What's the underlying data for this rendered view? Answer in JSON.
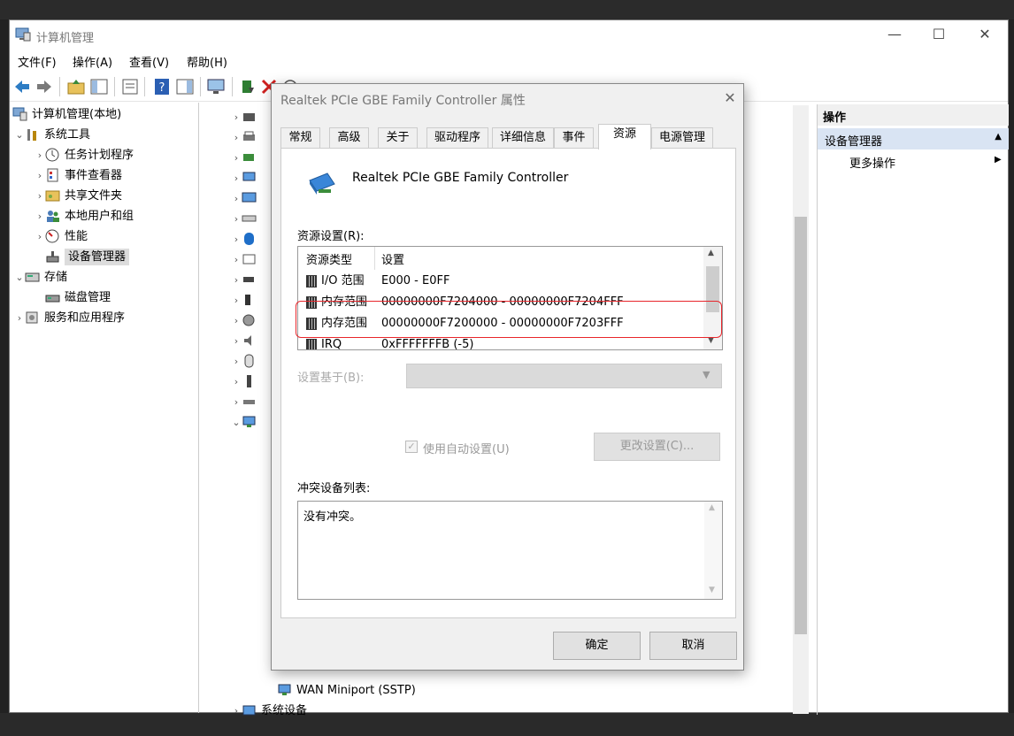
{
  "window": {
    "title": "计算机管理",
    "controls": {
      "minimize": "—",
      "maximize": "☐",
      "close": "✕"
    }
  },
  "menu": [
    "文件(F)",
    "操作(A)",
    "查看(V)",
    "帮助(H)"
  ],
  "toolbar": {
    "icons": [
      "back-arrow-icon",
      "forward-arrow-icon",
      "up-folder-icon",
      "show-hide-tree-icon",
      "properties-icon",
      "help-icon",
      "action-pane-icon",
      "monitor-icon",
      "update-driver-icon",
      "uninstall-icon",
      "scan-icon"
    ]
  },
  "tree": {
    "root": "计算机管理(本地)",
    "system_tools": "系统工具",
    "task_scheduler": "任务计划程序",
    "event_viewer": "事件查看器",
    "shared_folders": "共享文件夹",
    "local_users": "本地用户和组",
    "performance": "性能",
    "device_manager": "设备管理器",
    "storage": "存储",
    "disk_management": "磁盘管理",
    "services_apps": "服务和应用程序"
  },
  "center": {
    "visible_labels": [
      "WAN Miniport (SSTP)",
      "系统设备"
    ]
  },
  "actions": {
    "header": "操作",
    "selected": "设备管理器",
    "more": "更多操作"
  },
  "dialog": {
    "title": "Realtek PCIe GBE Family Controller 属性",
    "tabs": [
      "常规",
      "高级",
      "关于",
      "驱动程序",
      "详细信息",
      "事件",
      "资源",
      "电源管理"
    ],
    "active_tab": "资源",
    "device_name": "Realtek PCIe GBE Family Controller",
    "resource_settings_label": "资源设置(R):",
    "resource_columns": [
      "资源类型",
      "设置"
    ],
    "resources": [
      {
        "type": "I/O 范围",
        "setting": "E000 - E0FF"
      },
      {
        "type": "内存范围",
        "setting": "00000000F7204000 - 00000000F7204FFF"
      },
      {
        "type": "内存范围",
        "setting": "00000000F7200000 - 00000000F7203FFF"
      },
      {
        "type": "IRQ",
        "setting": "0xFFFFFFFB (-5)"
      }
    ],
    "setting_based_on_label": "设置基于(B):",
    "use_auto_label": "使用自动设置(U)",
    "use_auto_checked": true,
    "change_setting_button": "更改设置(C)...",
    "conflict_label": "冲突设备列表:",
    "conflict_text": "没有冲突。",
    "ok_button": "确定",
    "cancel_button": "取消"
  },
  "colors": {
    "highlight_box": "#e8262b",
    "action_selected_bg": "#d9e4f3",
    "disabled_text": "#999999"
  }
}
